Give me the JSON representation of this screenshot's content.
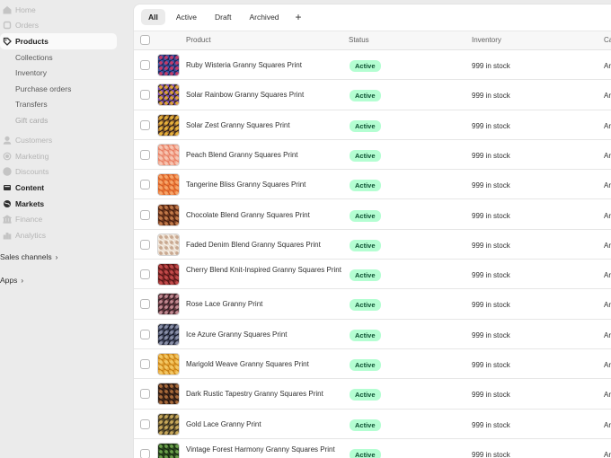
{
  "sidebar": {
    "items": [
      {
        "label": "Home",
        "icon": "home-icon",
        "state": "dim"
      },
      {
        "label": "Orders",
        "icon": "orders-icon",
        "state": "dim"
      },
      {
        "label": "Products",
        "icon": "tag-icon",
        "state": "active"
      },
      {
        "label": "Customers",
        "icon": "person-icon",
        "state": "dim"
      },
      {
        "label": "Marketing",
        "icon": "target-icon",
        "state": "dim"
      },
      {
        "label": "Discounts",
        "icon": "discount-icon",
        "state": "dim"
      },
      {
        "label": "Content",
        "icon": "content-icon",
        "state": "bold"
      },
      {
        "label": "Markets",
        "icon": "globe-icon",
        "state": "bold"
      },
      {
        "label": "Finance",
        "icon": "bank-icon",
        "state": "dim"
      },
      {
        "label": "Analytics",
        "icon": "chart-icon",
        "state": "dim"
      }
    ],
    "product_subitems": [
      "Collections",
      "Inventory",
      "Purchase orders",
      "Transfers",
      "Gift cards"
    ],
    "sales_channels": "Sales channels",
    "apps": "Apps",
    "chevron": "›"
  },
  "tabs": [
    "All",
    "Active",
    "Draft",
    "Archived"
  ],
  "add_tab": "+",
  "table": {
    "headers": {
      "product": "Product",
      "status": "Status",
      "inventory": "Inventory",
      "category": "Ca"
    },
    "rows": [
      {
        "name": "Ruby Wisteria Granny Squares Print",
        "status": "Active",
        "inventory": "999 in stock",
        "category": "Ar",
        "swatch": [
          "#1d2a5e",
          "#c43b6a",
          "#3d4f9e"
        ]
      },
      {
        "name": "Solar Rainbow Granny Squares Print",
        "status": "Active",
        "inventory": "999 in stock",
        "category": "Ar",
        "swatch": [
          "#3a2c20",
          "#e0a33a",
          "#7a4bb0"
        ]
      },
      {
        "name": "Solar Zest Granny Squares Print",
        "status": "Active",
        "inventory": "999 in stock",
        "category": "Ar",
        "swatch": [
          "#3b2a1c",
          "#e6b13a",
          "#9a6a2e"
        ]
      },
      {
        "name": "Peach Blend Granny Squares Print",
        "status": "Active",
        "inventory": "999 in stock",
        "category": "Ar",
        "swatch": [
          "#f1a58c",
          "#f7c6b3",
          "#e8836a"
        ]
      },
      {
        "name": "Tangerine Bliss Granny Squares Print",
        "status": "Active",
        "inventory": "999 in stock",
        "category": "Ar",
        "swatch": [
          "#ef7d3a",
          "#f6a66c",
          "#d4602a"
        ]
      },
      {
        "name": "Chocolate Blend Granny Squares Print",
        "status": "Active",
        "inventory": "999 in stock",
        "category": "Ar",
        "swatch": [
          "#7a3f22",
          "#c27a4a",
          "#4e2412"
        ]
      },
      {
        "name": "Faded Denim Blend Granny Squares Print",
        "status": "Active",
        "inventory": "999 in stock",
        "category": "Ar",
        "swatch": [
          "#e8d8c8",
          "#c8a890",
          "#f4ece2"
        ]
      },
      {
        "name": "Cherry Blend Knit-Inspired Granny Squares Print",
        "status": "Active",
        "inventory": "999 in stock",
        "category": "Ar",
        "swatch": [
          "#8a2a2a",
          "#c24a4a",
          "#5a1818"
        ]
      },
      {
        "name": "Rose Lace Granny Print",
        "status": "Active",
        "inventory": "999 in stock",
        "category": "Ar",
        "swatch": [
          "#3a2428",
          "#c28a92",
          "#6a3a44"
        ]
      },
      {
        "name": "Ice Azure Granny Squares Print",
        "status": "Active",
        "inventory": "999 in stock",
        "category": "Ar",
        "swatch": [
          "#1e2230",
          "#8a90a8",
          "#4a506a"
        ]
      },
      {
        "name": "Marigold Weave Granny Squares Print",
        "status": "Active",
        "inventory": "999 in stock",
        "category": "Ar",
        "swatch": [
          "#e8a83a",
          "#f2c866",
          "#c88418"
        ]
      },
      {
        "name": "Dark Rustic Tapestry Granny Squares Print",
        "status": "Active",
        "inventory": "999 in stock",
        "category": "Ar",
        "swatch": [
          "#4a2c1c",
          "#a86a3a",
          "#2a1810"
        ]
      },
      {
        "name": "Gold Lace Granny Print",
        "status": "Active",
        "inventory": "999 in stock",
        "category": "Ar",
        "swatch": [
          "#3a3220",
          "#c8a85a",
          "#6a5a30"
        ]
      },
      {
        "name": "Vintage Forest Harmony Granny Squares Print",
        "status": "Active",
        "inventory": "999 in stock",
        "category": "Ar",
        "swatch": [
          "#2a4a1e",
          "#6aa04a",
          "#1a2e12"
        ]
      }
    ]
  }
}
